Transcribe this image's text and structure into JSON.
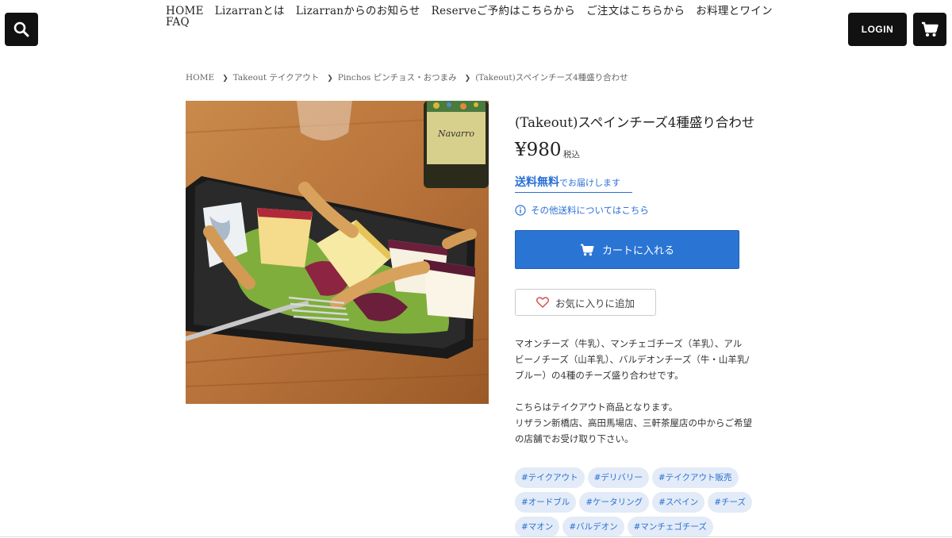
{
  "header": {
    "nav_items": [
      "HOME",
      "Lizarranとは",
      "Lizarranからのお知らせ",
      "Reserveご予約はこちらから",
      "ご注文はこちらから",
      "お料理とワイン",
      "FAQ"
    ],
    "login_label": "LOGIN",
    "icons": {
      "search": "search-icon",
      "cart": "cart-icon"
    }
  },
  "breadcrumb": [
    "HOME",
    "Takeout テイクアウト",
    "Pinchos ピンチョス・おつまみ",
    "(Takeout)スペインチーズ4種盛り合わせ"
  ],
  "product": {
    "title": "(Takeout)スペインチーズ4種盛り合わせ",
    "price": "¥980",
    "tax_label": "税込",
    "shipping_free_big": "送料無料",
    "shipping_free_small": "でお届けします",
    "shipping_info": "その他送料についてはこちら",
    "add_to_cart": "カートに入れる",
    "favorite": "お気に入りに追加",
    "description": [
      "マオンチーズ（牛乳）、マンチェゴチーズ（羊乳）、アル",
      "ビーノチーズ（山羊乳）、バルデオンチーズ（牛・山羊乳/",
      "ブルー）の4種のチーズ盛り合わせです。",
      "",
      "こちらはテイクアウト商品となります。",
      "リザラン新橋店、高田馬場店、三軒茶屋店の中からご希望",
      "の店舗でお受け取り下さい。"
    ],
    "tags": [
      [
        "#テイクアウト",
        "#デリバリー",
        "#テイクアウト販売"
      ],
      [
        "#オードブル",
        "#ケータリング",
        "#スペイン",
        "#チーズ"
      ],
      [
        "#マオン",
        "#バルデオン",
        "#マンチェゴチーズ"
      ]
    ],
    "wine_label_text": "Navarro"
  },
  "colors": {
    "accent": "#2a74d4",
    "dark": "#111111",
    "tag_bg": "#e2ebf7"
  }
}
